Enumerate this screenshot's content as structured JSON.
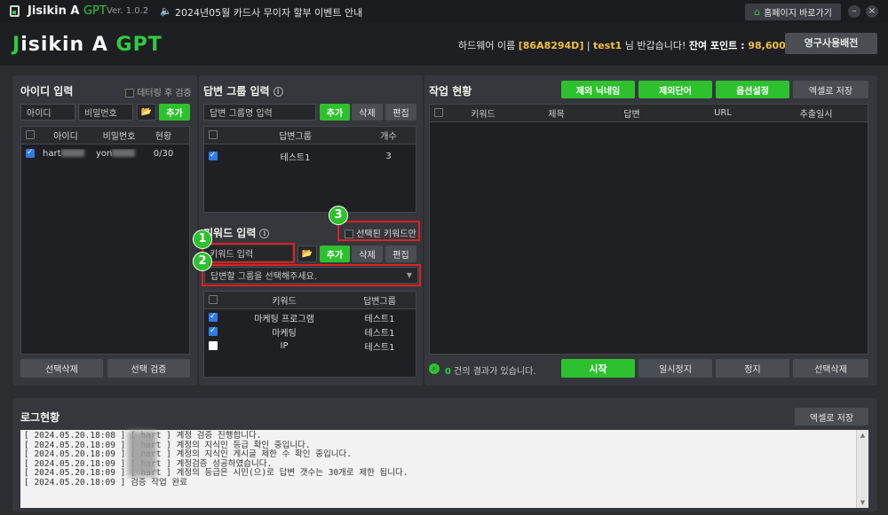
{
  "titlebar": {
    "app_name_main": "Jisikin A ",
    "app_name_accent": "GPT",
    "version": "Ver. 1.0.2",
    "notice": "2024년05월 카드사 무이자 할부 이벤트 안내",
    "home_button": "홈페이지 바로가기",
    "minimize": "–",
    "close": "×"
  },
  "header": {
    "logo_j": "J",
    "logo_rest": "isikin A ",
    "logo_gpt": "GPT",
    "hw_label": "하드웨어 이름 ",
    "hw_value": "[86A8294D]",
    "sep": " | ",
    "user_id": "test1",
    "greeting": " 님 반갑습니다! ",
    "points_label": "잔여 포인트 : ",
    "points_value": "98,600 P",
    "perm_button": "영구사용배전"
  },
  "id_panel": {
    "title": "아이디 입력",
    "after_verify_label": "데터링 후 검증",
    "id_placeholder": "아이디",
    "pw_placeholder": "비밀번호",
    "add_button": "추가",
    "columns": [
      "아이디",
      "비밀번호",
      "현황"
    ],
    "rows": [
      {
        "id": "hart",
        "pw": "yon",
        "status": "0/30",
        "checked": true
      }
    ],
    "delete_selected": "선택삭제",
    "verify_selected": "선택 검증"
  },
  "answer_group_panel": {
    "title": "답변 그룹 입력",
    "name_placeholder": "답변 그룹명 입력",
    "add_button": "추가",
    "delete_button": "삭제",
    "edit_button": "편집",
    "columns": [
      "답변그룹",
      "개수"
    ],
    "rows": [
      {
        "group": "테스트1",
        "count": "3",
        "checked": true
      }
    ]
  },
  "keyword_panel": {
    "title": "키워드 입력",
    "selected_only_label": "선택된 키워드만",
    "keyword_placeholder": "키워드 입력",
    "add_button": "추가",
    "delete_button": "삭제",
    "edit_button": "편집",
    "group_select_value": "답변할 그룹을 선택해주세요.",
    "columns": [
      "키워드",
      "답변그룹"
    ],
    "rows": [
      {
        "keyword": "마케팅 프로그램",
        "group": "테스트1",
        "checked": true
      },
      {
        "keyword": "마케팅",
        "group": "테스트1",
        "checked": true
      },
      {
        "keyword": "IP",
        "group": "테스트1",
        "checked": false
      }
    ],
    "badges": [
      "1",
      "2",
      "3"
    ]
  },
  "work_panel": {
    "title": "작업 현황",
    "exclude_nick_button": "제외 닉네임",
    "exclude_word_button": "제외단어",
    "options_button": "옵션설정",
    "export_button": "엑셀로 저장",
    "columns": [
      "키워드",
      "제목",
      "답변",
      "URL",
      "추출일시"
    ],
    "result_count": "0",
    "result_text": " 건의 결과가 있습니다.",
    "start_button": "시작",
    "pause_button": "일시정지",
    "stop_button": "정지",
    "delete_selected": "선택삭제"
  },
  "log_panel": {
    "title": "로그현황",
    "export_button": "엑셀로 저장",
    "lines": [
      "[ 2024.05.20.18:08 ] [ hart         ] 계정 검증 진행합니다.",
      "[ 2024.05.20.18:09 ] [ hart         ] 계정의 지식인 등급 확인 중입니다.",
      "[ 2024.05.20.18:09 ] [ hart         ] 계정의 지식인 게시글 제한 수 확인 중입니다.",
      "[ 2024.05.20.18:09 ] [ hart         ] 계정검증 성공하였습니다.",
      "[ 2024.05.20.18:09 ] [ hart         ] 계정의 등급은 시민(으)로 답변 갯수는 30개로 제한 됩니다.",
      "[ 2024.05.20.18:09 ] 검증 작업 완료"
    ]
  }
}
